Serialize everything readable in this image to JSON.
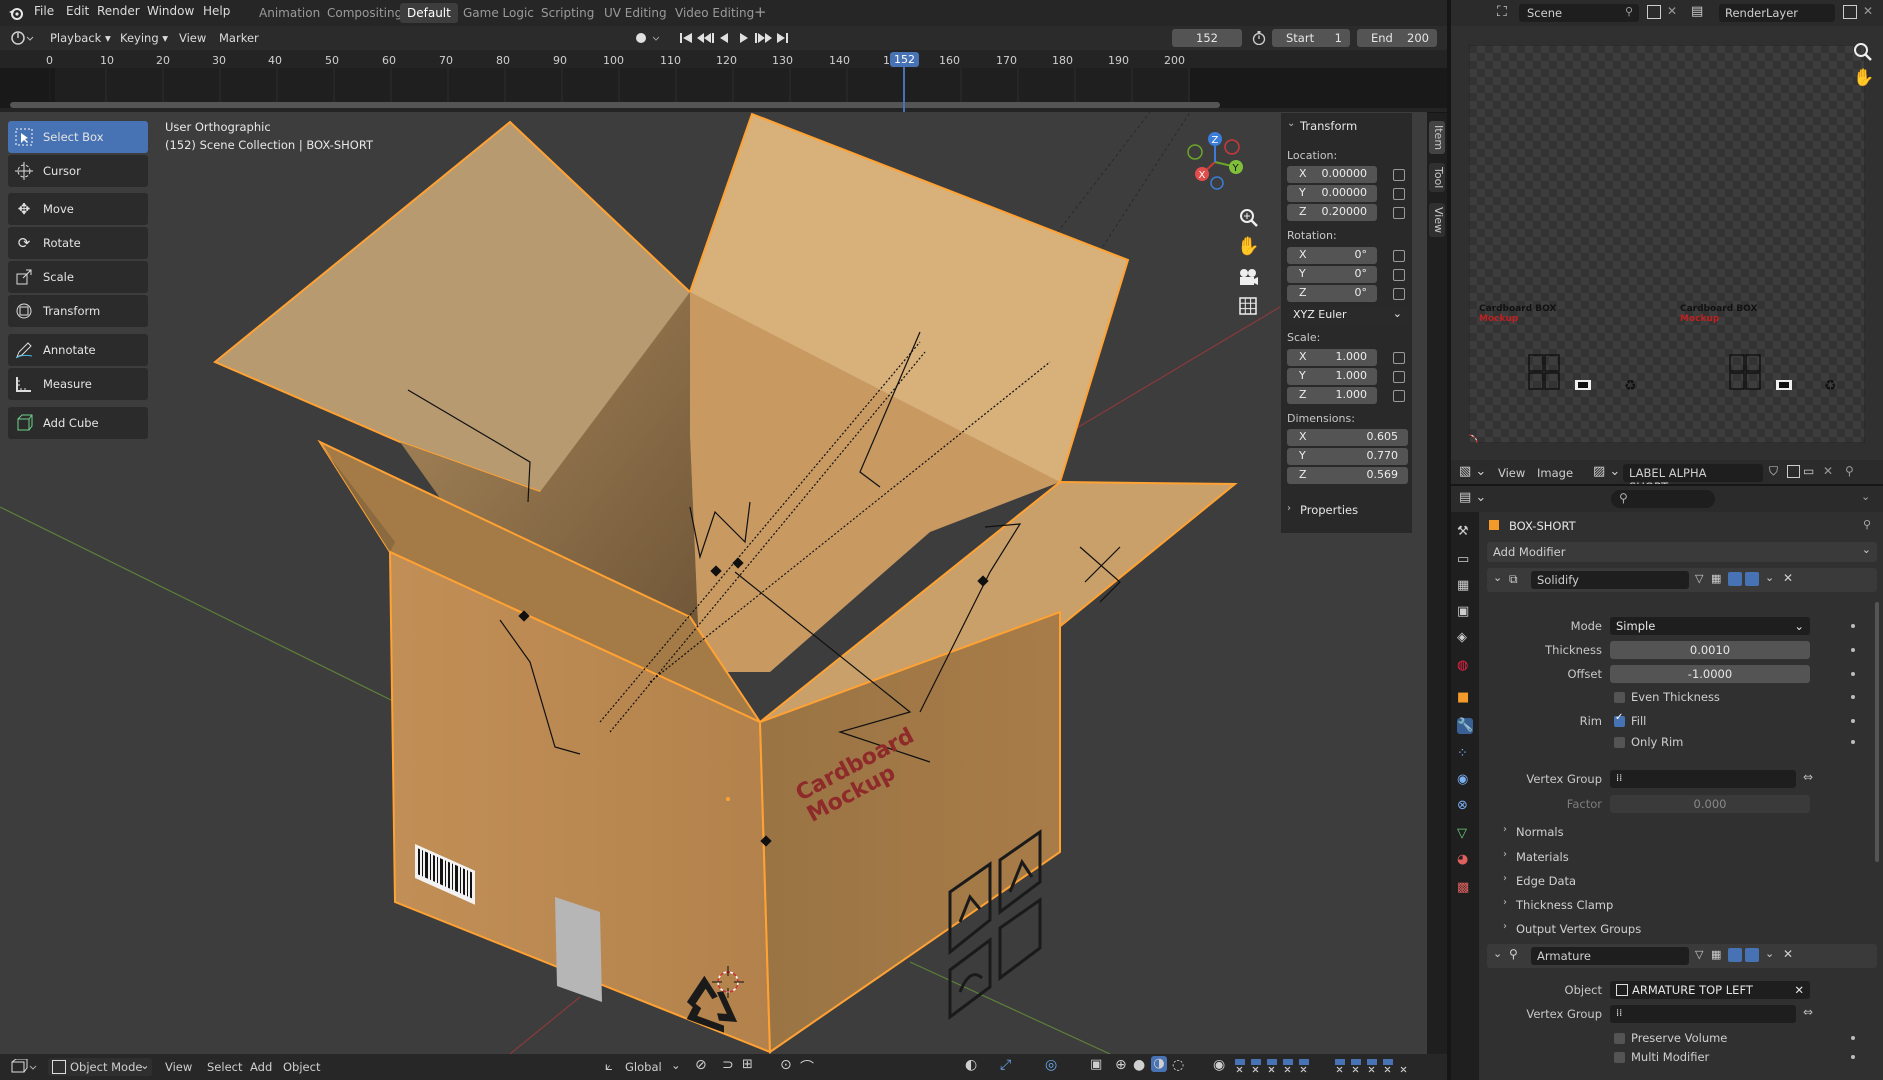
{
  "menu": {
    "file": "File",
    "edit": "Edit",
    "render": "Render",
    "window": "Window",
    "help": "Help"
  },
  "workspaces": [
    "Animation",
    "Compositing",
    "Default",
    "Game Logic",
    "Scripting",
    "UV Editing",
    "Video Editing"
  ],
  "timeline": {
    "playback": "Playback",
    "keying": "Keying",
    "view": "View",
    "marker": "Marker",
    "current_frame": "152",
    "start_label": "Start",
    "start_value": "1",
    "end_label": "End",
    "end_value": "200",
    "ticks": [
      "0",
      "10",
      "20",
      "30",
      "40",
      "50",
      "60",
      "70",
      "80",
      "90",
      "100",
      "110",
      "120",
      "130",
      "140",
      "1",
      "152",
      "160",
      "170",
      "180",
      "190",
      "200"
    ]
  },
  "viewport": {
    "view_name": "User Orthographic",
    "collection": "(152) Scene Collection | BOX-SHORT",
    "box_print_1": "Cardboard",
    "box_print_2": "Mockup"
  },
  "tools": [
    "Select Box",
    "Cursor",
    "Move",
    "Rotate",
    "Scale",
    "Transform",
    "Annotate",
    "Measure",
    "Add Cube"
  ],
  "transform": {
    "title": "Transform",
    "location_label": "Location:",
    "location": [
      {
        "axis": "X",
        "value": "0.00000"
      },
      {
        "axis": "Y",
        "value": "0.00000"
      },
      {
        "axis": "Z",
        "value": "0.20000"
      }
    ],
    "rotation_label": "Rotation:",
    "rotation": [
      {
        "axis": "X",
        "value": "0°"
      },
      {
        "axis": "Y",
        "value": "0°"
      },
      {
        "axis": "Z",
        "value": "0°"
      }
    ],
    "rotation_mode": "XYZ Euler",
    "scale_label": "Scale:",
    "scale": [
      {
        "axis": "X",
        "value": "1.000"
      },
      {
        "axis": "Y",
        "value": "1.000"
      },
      {
        "axis": "Z",
        "value": "1.000"
      }
    ],
    "dimensions_label": "Dimensions:",
    "dimensions": [
      {
        "axis": "X",
        "value": "0.605"
      },
      {
        "axis": "Y",
        "value": "0.770"
      },
      {
        "axis": "Z",
        "value": "0.569"
      }
    ],
    "properties": "Properties"
  },
  "side_tabs": [
    "Item",
    "Tool",
    "View"
  ],
  "footer": {
    "mode": "Object Mode",
    "view": "View",
    "select": "Select",
    "add": "Add",
    "object": "Object",
    "orientation": "Global"
  },
  "image_editor": {
    "scene": "Scene",
    "render_layer": "RenderLayer",
    "view": "View",
    "image": "Image",
    "image_name": "LABEL ALPHA SHORT.png",
    "label_text": "Cardboard BOX",
    "label_sub": "Mockup"
  },
  "properties": {
    "object_name": "BOX-SHORT",
    "add_modifier": "Add Modifier",
    "solidify": {
      "name": "Solidify",
      "mode_label": "Mode",
      "mode": "Simple",
      "thickness_label": "Thickness",
      "thickness": "0.0010",
      "offset_label": "Offset",
      "offset": "-1.0000",
      "even_thickness": "Even Thickness",
      "rim_label": "Rim",
      "fill": "Fill",
      "only_rim": "Only Rim",
      "vertex_group_label": "Vertex Group",
      "factor_label": "Factor",
      "factor": "0.000",
      "subpanels": [
        "Normals",
        "Materials",
        "Edge Data",
        "Thickness Clamp",
        "Output Vertex Groups"
      ]
    },
    "armature": {
      "name": "Armature",
      "object_label": "Object",
      "object": "ARMATURE TOP LEFT",
      "vertex_group_label": "Vertex Group",
      "preserve_volume": "Preserve Volume",
      "multi_modifier": "Multi Modifier"
    }
  },
  "colors": {
    "accent": "#4772b3",
    "selection": "#ffa233",
    "cardboard": "#c99a5e",
    "cardboard_shadow": "#8a6a3e"
  }
}
